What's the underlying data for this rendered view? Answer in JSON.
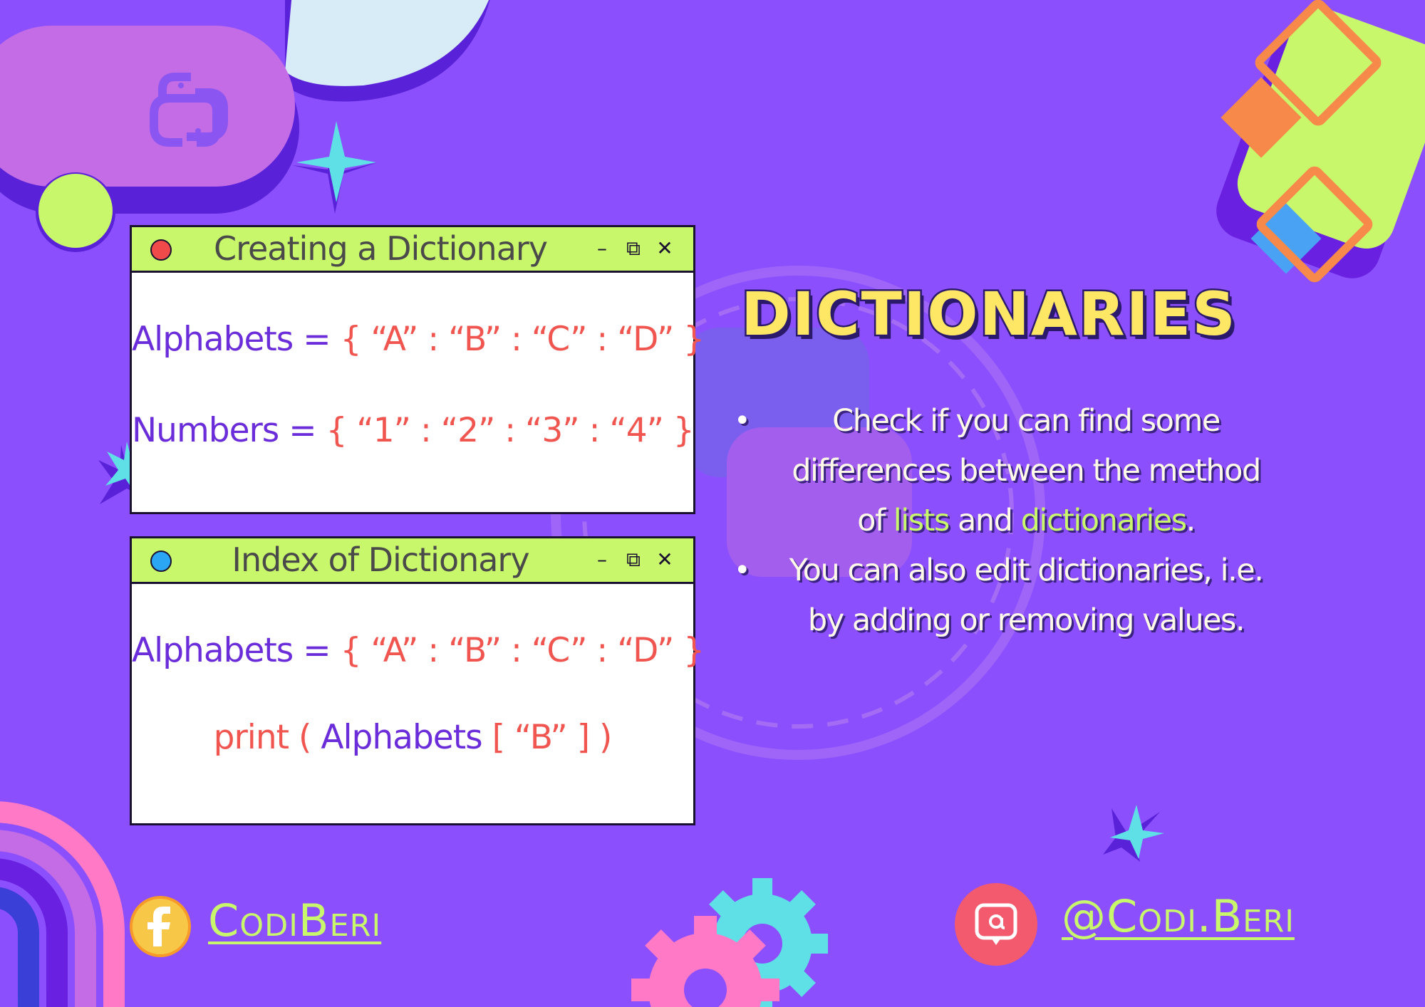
{
  "colors": {
    "background": "#8b4ffd",
    "titlebar": "#c9f76b",
    "code_purple": "#6b2dd9",
    "code_red": "#f0554f",
    "heading_yellow": "#ffe766",
    "highlight_green": "#c9f76b"
  },
  "heading": "DICTIONARIES",
  "windows": [
    {
      "title": "Creating a Dictionary",
      "dot_color": "#f04a4a",
      "lines": [
        {
          "var": "Alphabets =",
          "value": "{ “A” : “B” : “C” : “D” }"
        },
        {
          "var": "Numbers =",
          "value": "{ “1” : “2” : “3” : “4” }"
        }
      ]
    },
    {
      "title": "Index of Dictionary",
      "dot_color": "#2aa6f5",
      "lines": [
        {
          "var": "Alphabets =",
          "value": "{ “A” : “B” : “C” : “D” }"
        },
        {
          "print_kw": "print (",
          "arg": "Alphabets",
          "index": "[ “B” ] )"
        }
      ]
    }
  ],
  "window_controls": {
    "minimize": "–",
    "maximize": "⧉",
    "close": "✕"
  },
  "bullets": {
    "b1_pre": "Check if you can find some differences between the method of ",
    "b1_hl1": "lists",
    "b1_mid": " and ",
    "b1_hl2": "dictionaries",
    "b1_post": ".",
    "b2": "You can also edit dictionaries, i.e. by adding or removing values."
  },
  "social": {
    "facebook": "CodiBeri",
    "instagram": "@Codi.Beri",
    "facebook_icon": "facebook-icon",
    "instagram_icon": "at-sign-icon"
  }
}
